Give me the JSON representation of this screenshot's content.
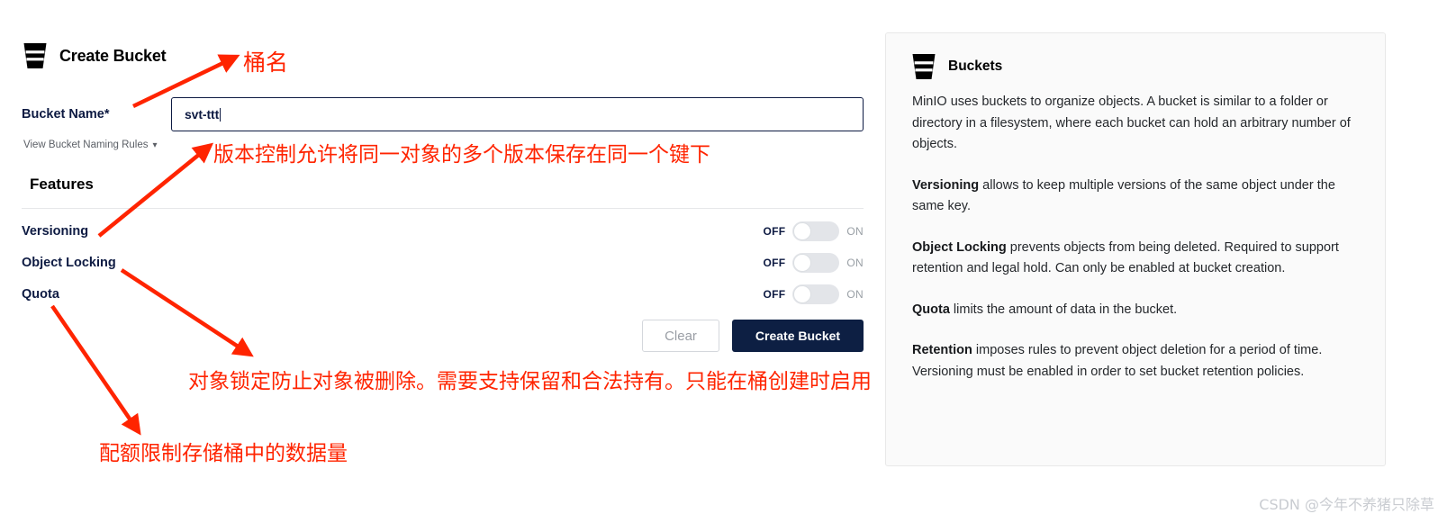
{
  "form": {
    "icon": "bucket-icon",
    "title": "Create Bucket",
    "bucket_name_label": "Bucket Name*",
    "bucket_name_value": "svt-ttt",
    "bucket_name_placeholder": "",
    "naming_rules_link": "View Bucket Naming Rules",
    "naming_rules_chevron": "chevron-down-icon",
    "features_heading": "Features",
    "toggles": [
      {
        "label": "Versioning",
        "off_label": "OFF",
        "on_label": "ON",
        "state": "off"
      },
      {
        "label": "Object Locking",
        "off_label": "OFF",
        "on_label": "ON",
        "state": "off"
      },
      {
        "label": "Quota",
        "off_label": "OFF",
        "on_label": "ON",
        "state": "off"
      }
    ],
    "clear_button": "Clear",
    "create_button": "Create Bucket"
  },
  "info": {
    "icon": "bucket-icon",
    "title": "Buckets",
    "paragraphs": [
      {
        "bold": "",
        "text": "MinIO uses buckets to organize objects. A bucket is similar to a folder or directory in a filesystem, where each bucket can hold an arbitrary number of objects."
      },
      {
        "bold": "Versioning",
        "text": " allows to keep multiple versions of the same object under the same key."
      },
      {
        "bold": "Object Locking",
        "text": " prevents objects from being deleted. Required to support retention and legal hold. Can only be enabled at bucket creation."
      },
      {
        "bold": "Quota",
        "text": " limits the amount of data in the bucket."
      },
      {
        "bold": "Retention",
        "text": " imposes rules to prevent object deletion for a period of time. Versioning must be enabled in order to set bucket retention policies."
      }
    ]
  },
  "annotations": {
    "color": "#ff2400",
    "bucket_name": "桶名",
    "versioning": "版本控制允许将同一对象的多个版本保存在同一个键下",
    "object_locking": "对象锁定防止对象被删除。需要支持保留和合法持有。只能在桶创建时启用",
    "quota": "配额限制存储桶中的数据量"
  },
  "watermark": "CSDN @今年不养猪只除草",
  "colors": {
    "accent_navy": "#0d1f43",
    "label_navy": "#0d1a42",
    "annotation_red": "#ff2400",
    "panel_bg": "#fafafa",
    "toggle_track": "#e3e5e9"
  }
}
